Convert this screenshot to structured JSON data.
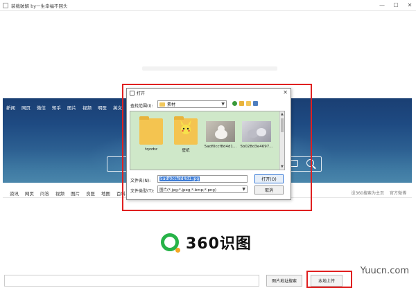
{
  "window": {
    "title": "装载破解 by一生幸福不回头"
  },
  "controls": {
    "minimize": "—",
    "maximize": "☐",
    "close": "✕"
  },
  "topnav": [
    "新闻",
    "网页",
    "微信",
    "知乎",
    "图片",
    "视频",
    "明医",
    "英文"
  ],
  "subnav": [
    "资讯",
    "网页",
    "问答",
    "视频",
    "图片",
    "良医",
    "地图",
    "百科"
  ],
  "subnav_right": [
    "设360搜索为主页",
    "官方微博"
  ],
  "logo": {
    "text": "360识图"
  },
  "bottom": {
    "url_search": "图片地址搜索",
    "local_upload": "本地上传"
  },
  "watermark": "Yuucn.com",
  "dialog": {
    "title": "打开",
    "lookin_label": "查找范围(I):",
    "lookin_value": "素材",
    "files": [
      {
        "name": "tqzzbz",
        "kind": "folder"
      },
      {
        "name": "壁纸",
        "kind": "folder-pikachu"
      },
      {
        "name": "5adf0ccf8d4d1...",
        "kind": "photo-cat"
      },
      {
        "name": "5b028d3e4697...",
        "kind": "photo-gray"
      }
    ],
    "filename_label": "文件名(N):",
    "filename_value": "5adf0ccf8d4d1.jpg",
    "filetype_label": "文件类型(T):",
    "filetype_value": "图片(*.jpg;*.jpeg;*.bmp;*.png)",
    "open_button": "打开(O)",
    "cancel_button": "取消"
  },
  "colors": {
    "highlight_red": "#e02020",
    "banner_blue": "#1e4a82",
    "logo_green": "#27b348",
    "file_area_bg": "#cfe8c9"
  }
}
